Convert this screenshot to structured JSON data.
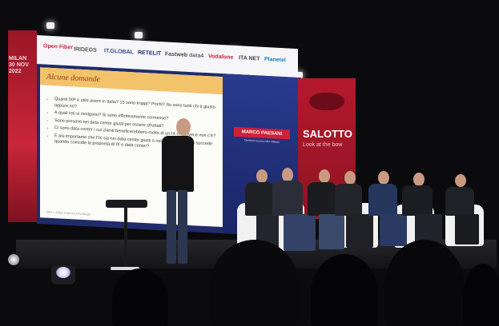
{
  "left_wall": {
    "lines": [
      "MILAN",
      "30 NOV",
      "2022"
    ]
  },
  "banner": {
    "logos": [
      "Open Fiber",
      "IRIDEOS",
      "IT.GLOBAL",
      "RETELIT",
      "Fastweb",
      "data4",
      "Vodafone",
      "ITA NET",
      "Planetel"
    ]
  },
  "slide": {
    "title": "Alcune domande",
    "bullets": [
      "Quanti IXP è utile avere in Italia? 15 sono troppi? Pochi? Se sono tanti chi è giusto oppure no?",
      "A quali reti si rivolgono? Si sono effettivamente connesse?",
      "Sono presenti nei data center giusti per essere sfruttati?",
      "Ci sono data center i cui clienti beneficerebbero molto di un IX che invece non c'è?",
      "È più importante che l'IX sia nei data center giusti o nei giusti DC? Cosa succede quando coincide la proprietà di IX e data center?"
    ],
    "footer": "MIX – Milan Internet eXchange"
  },
  "speaker_panel": {
    "name": "MARCO PAESANI",
    "role": "Direttore tecnico MIX Milano"
  },
  "salotto_panel": {
    "title": "SALOTTO",
    "subtitle": "Look at the bow"
  },
  "colors": {
    "brand_red": "#c8263a",
    "screen_blue": "#1f2b6b",
    "slide_bar": "#f3c36b"
  }
}
